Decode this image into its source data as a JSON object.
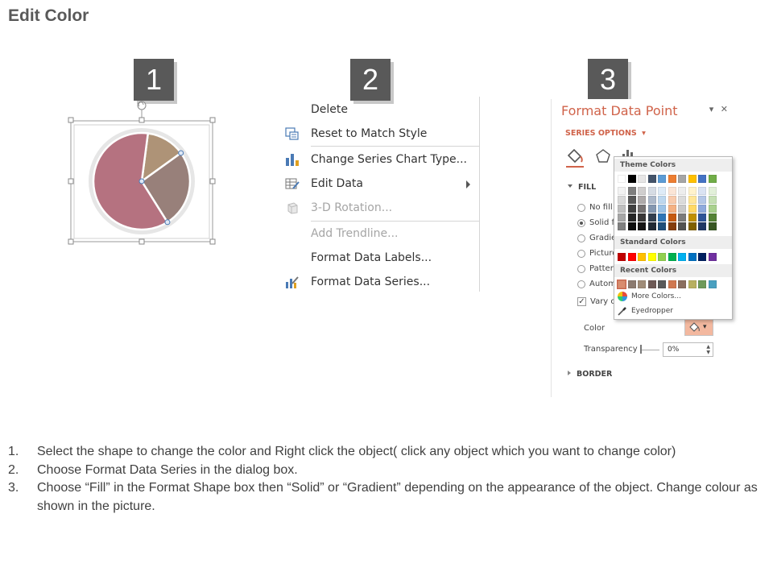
{
  "page": {
    "title": "Edit Color"
  },
  "steps_badges": [
    "1",
    "2",
    "3"
  ],
  "pie": {
    "slices": [
      {
        "label": "slice-1",
        "value": 61,
        "color": "#b57280"
      },
      {
        "label": "slice-2",
        "value": 13,
        "color": "#ae9377"
      },
      {
        "label": "slice-3",
        "value": 26,
        "color": "#98807a"
      }
    ]
  },
  "context_menu": {
    "items": [
      {
        "label": "Delete",
        "icon": "none"
      },
      {
        "label": "Reset to Match Style",
        "icon": "reset-style-icon"
      },
      {
        "label": "Change Series Chart Type...",
        "icon": "bar-chart-icon"
      },
      {
        "label": "Edit Data",
        "icon": "edit-data-icon",
        "submenu": true
      },
      {
        "label": "3-D Rotation...",
        "icon": "cube-icon",
        "disabled": true
      },
      {
        "label": "Add Trendline...",
        "icon": "none",
        "disabled": true
      },
      {
        "label": "Format Data Labels...",
        "icon": "none"
      },
      {
        "label": "Format Data Series...",
        "icon": "format-series-icon"
      }
    ]
  },
  "format_pane": {
    "title": "Format Data Point",
    "series_options": "SERIES OPTIONS",
    "fill_header": "FILL",
    "options": [
      "No fill",
      "Solid fi",
      "Gradie",
      "Picture",
      "Patter",
      "Autom"
    ],
    "vary": "Vary co",
    "color_label": "Color",
    "transparency_label": "Transparency",
    "transparency_value": "0%",
    "border_header": "BORDER",
    "accent": "#d0634a"
  },
  "picker": {
    "theme_header": "Theme Colors",
    "standard_header": "Standard Colors",
    "recent_header": "Recent Colors",
    "more_colors": "More Colors...",
    "eyedropper": "Eyedropper",
    "theme_top": [
      "#ffffff",
      "#000000",
      "#e7e6e6",
      "#44546a",
      "#5b9bd5",
      "#ed7d31",
      "#a5a5a5",
      "#ffc000",
      "#4472c4",
      "#70ad47"
    ],
    "theme_cols": [
      [
        "#f2f2f2",
        "#d9d9d9",
        "#bfbfbf",
        "#a6a6a6",
        "#808080"
      ],
      [
        "#7f7f7f",
        "#595959",
        "#404040",
        "#262626",
        "#0d0d0d"
      ],
      [
        "#d0cece",
        "#aeaaaa",
        "#757171",
        "#3a3838",
        "#171616"
      ],
      [
        "#d6dce4",
        "#adb9ca",
        "#8497b0",
        "#333f4f",
        "#222a35"
      ],
      [
        "#deebf7",
        "#bdd7ee",
        "#9dc3e6",
        "#2e75b6",
        "#1f4e79"
      ],
      [
        "#fbe5d6",
        "#f8cbad",
        "#f4b183",
        "#c55a11",
        "#843c0c"
      ],
      [
        "#ededed",
        "#dbdbdb",
        "#c9c9c9",
        "#7b7b7b",
        "#525252"
      ],
      [
        "#fff2cc",
        "#ffe699",
        "#ffd966",
        "#bf9000",
        "#7f6000"
      ],
      [
        "#dae3f3",
        "#b4c7e7",
        "#8faadc",
        "#2f5597",
        "#203864"
      ],
      [
        "#e2f0d9",
        "#c5e0b4",
        "#a9d18e",
        "#548235",
        "#385723"
      ]
    ],
    "standard": [
      "#c00000",
      "#ff0000",
      "#ffc000",
      "#ffff00",
      "#92d050",
      "#00b050",
      "#00b0f0",
      "#0070c0",
      "#002060",
      "#7030a0"
    ],
    "recent": [
      "#d98c6e",
      "#8c7b70",
      "#a08c78",
      "#6e5a56",
      "#5a5a5a",
      "#d07850",
      "#8a6e5e",
      "#b8b060",
      "#6e9a5a",
      "#4aa0c0"
    ]
  },
  "instructions": [
    {
      "n": "1.",
      "text": "Select the shape to change the color and Right click the object( click any object which you want to change color)"
    },
    {
      "n": "2.",
      "text": "Choose Format Data Series in the dialog box."
    },
    {
      "n": "3.",
      "text": "Choose “Fill” in the Format Shape box then “Solid” or “Gradient” depending on the appearance of the object. Change colour as shown in the picture."
    }
  ]
}
